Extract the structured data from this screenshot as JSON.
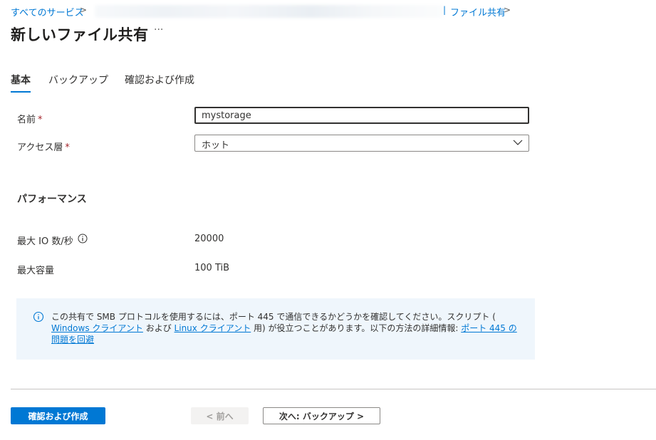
{
  "breadcrumb": {
    "all_services": "すべてのサービス",
    "file_shares": "ファイル共有",
    "separator": ">",
    "pipe": "|"
  },
  "page": {
    "title": "新しいファイル共有",
    "more_label": "···"
  },
  "tabs": [
    {
      "label": "基本",
      "active": true
    },
    {
      "label": "バックアップ",
      "active": false
    },
    {
      "label": "確認および作成",
      "active": false
    }
  ],
  "form": {
    "name_label": "名前",
    "name_value": "mystorage",
    "access_tier_label": "アクセス層",
    "access_tier_value": "ホット",
    "required_mark": "*"
  },
  "performance": {
    "heading": "パフォーマンス",
    "max_io_label": "最大 IO 数/秒",
    "max_io_value": "20000",
    "max_capacity_label": "最大容量",
    "max_capacity_value": "100 TiB"
  },
  "info": {
    "text_part1": "この共有で SMB プロトコルを使用するには、ポート 445 で通信できるかどうかを確認してください。スクリプト ( ",
    "windows_link": "Windows クライアント",
    "text_part2": " および ",
    "linux_link": "Linux クライアント",
    "text_part3": " 用) が役立つことがあります。以下の方法の詳細情報: ",
    "port_link": "ポート 445 の問題を回避"
  },
  "footer": {
    "review_create": "確認および作成",
    "previous": "< 前へ",
    "next": "次へ: バックアップ >"
  },
  "colors": {
    "accent": "#0078d4",
    "info_bg": "#eff6fc",
    "required": "#a4262c"
  }
}
